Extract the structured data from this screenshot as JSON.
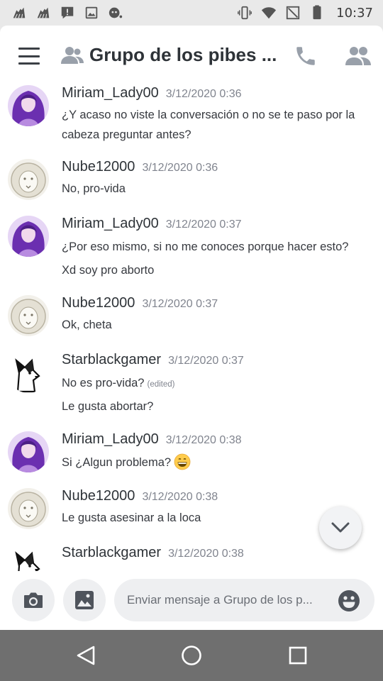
{
  "status_bar": {
    "time": "10:37",
    "left_icons": [
      "cleaner-app-icon",
      "cleaner-app-icon",
      "alert-bubble-icon",
      "image-icon",
      "cat-face-icon"
    ],
    "right_icons": [
      "vibrate-icon",
      "wifi-icon",
      "no-signal-icon",
      "battery-icon"
    ]
  },
  "header": {
    "title": "Grupo de los pibes ...",
    "icons": [
      "hamburger-menu-icon",
      "group-chat-icon",
      "call-icon",
      "members-icon"
    ]
  },
  "messages": [
    {
      "author": "Miriam_Lady00",
      "timestamp": "3/12/2020 0:36",
      "avatar": "purple-haired-woman-avatar",
      "lines": [
        "¿Y acaso no viste la conversación o no se te paso por la",
        "cabeza preguntar antes?"
      ]
    },
    {
      "author": "Nube12000",
      "timestamp": "3/12/2020 0:36",
      "avatar": "white-lion-avatar",
      "lines": [
        "No, pro-vida"
      ]
    },
    {
      "author": "Miriam_Lady00",
      "timestamp": "3/12/2020 0:37",
      "avatar": "purple-haired-woman-avatar",
      "lines": [
        "¿Por eso mismo, si no me conoces porque hacer esto?",
        "Xd soy pro aborto"
      ]
    },
    {
      "author": "Nube12000",
      "timestamp": "3/12/2020 0:37",
      "avatar": "white-lion-avatar",
      "lines": [
        "Ok, cheta"
      ]
    },
    {
      "author": "Starblackgamer",
      "timestamp": "3/12/2020 0:37",
      "avatar": "black-white-wolf-avatar",
      "lines": [
        "No es pro-vida?",
        "Le gusta abortar?"
      ],
      "edited_label": "(edited)"
    },
    {
      "author": "Miriam_Lady00",
      "timestamp": "3/12/2020 0:38",
      "avatar": "purple-haired-woman-avatar",
      "lines": [
        "Si ¿Algun problema?"
      ],
      "emoji": "grinning-face-emoji"
    },
    {
      "author": "Nube12000",
      "timestamp": "3/12/2020 0:38",
      "avatar": "white-lion-avatar",
      "lines": [
        "Le gusta asesinar a la loca"
      ]
    },
    {
      "author": "Starblackgamer",
      "timestamp": "3/12/2020 0:38",
      "avatar": "black-white-wolf-avatar",
      "lines": []
    }
  ],
  "composer": {
    "placeholder": "Enviar mensaje a Grupo de los p...",
    "value": ""
  },
  "colors": {
    "status_bar_bg": "#e9e9e9",
    "app_bg": "#ffffff",
    "header_icon": "#99a0aa",
    "text_primary": "#2e3338",
    "timestamp": "#80848e",
    "input_bg": "#eeeff1",
    "nav_bar_bg": "#6f6f6f",
    "avatar_purple": "#8a4fc6"
  }
}
